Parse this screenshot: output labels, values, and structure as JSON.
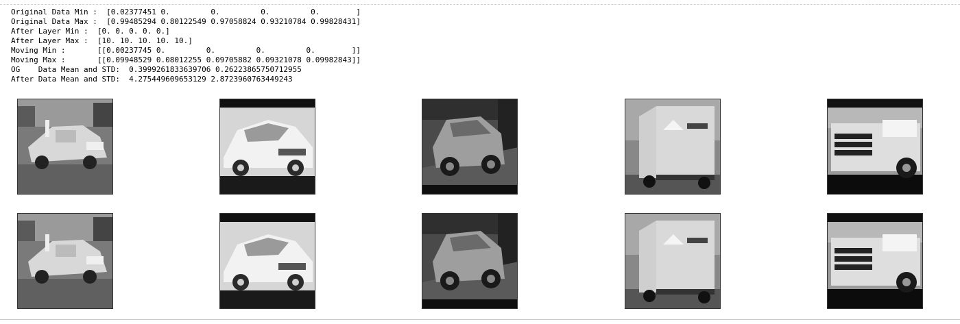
{
  "stdout_lines": [
    "Original Data Min :  [0.02377451 0.         0.         0.         0.        ]",
    "Original Data Max :  [0.99485294 0.80122549 0.97058824 0.93210784 0.99828431]",
    "After Layer Min :  [0. 0. 0. 0. 0.]",
    "After Layer Max :  [10. 10. 10. 10. 10.]",
    "Moving Min :       [[0.00237745 0.         0.         0.         0.        ]]",
    "Moving Max :       [[0.09948529 0.08012255 0.09705882 0.09321078 0.09982843]]",
    "OG    Data Mean and STD:  0.3999261833639706 0.26223865750712955",
    "After Data Mean and STD:  4.275449609653129 2.8723960763449243"
  ],
  "image_rows": [
    {
      "row": "original",
      "images": [
        {
          "subject": "grey-vehicle-street"
        },
        {
          "subject": "white-hatchback-car"
        },
        {
          "subject": "small-smart-car"
        },
        {
          "subject": "delivery-truck-rear"
        },
        {
          "subject": "fire-truck-side"
        }
      ]
    },
    {
      "row": "after-layer",
      "images": [
        {
          "subject": "grey-vehicle-street"
        },
        {
          "subject": "white-hatchback-car"
        },
        {
          "subject": "small-smart-car"
        },
        {
          "subject": "delivery-truck-rear"
        },
        {
          "subject": "fire-truck-side"
        }
      ]
    }
  ],
  "colors": {
    "background": "#ffffff",
    "text": "#000000",
    "rule": "#cfcfcf"
  }
}
